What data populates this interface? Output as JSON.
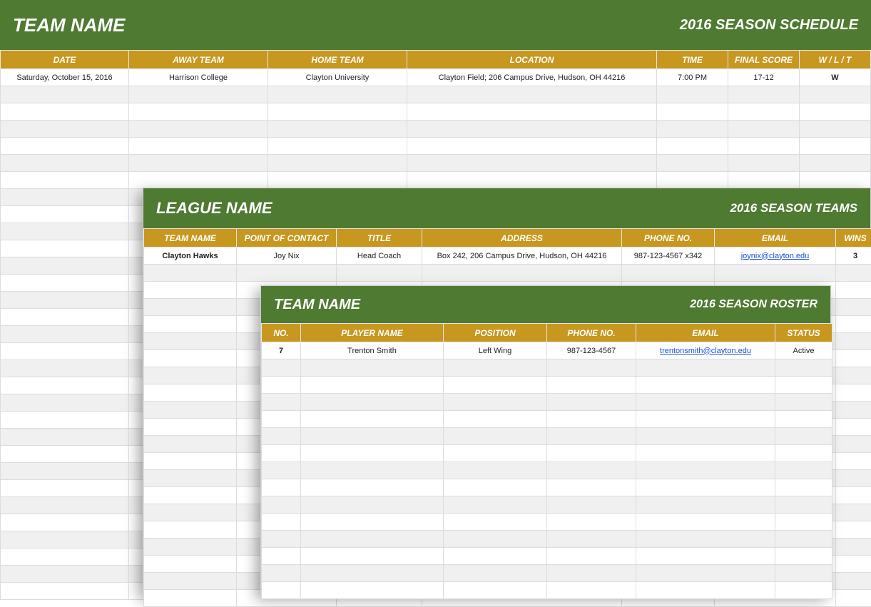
{
  "schedule": {
    "title": "TEAM NAME",
    "subtitle": "2016 SEASON SCHEDULE",
    "headers": {
      "date": "DATE",
      "away": "AWAY TEAM",
      "home": "HOME TEAM",
      "location": "LOCATION",
      "time": "TIME",
      "score": "FINAL SCORE",
      "wlt": "W / L / T"
    },
    "row": {
      "date": "Saturday, October 15, 2016",
      "away": "Harrison College",
      "home": "Clayton University",
      "location": "Clayton Field; 206 Campus Drive, Hudson, OH  44216",
      "time": "7:00 PM",
      "score": "17-12",
      "wlt": "W"
    }
  },
  "league": {
    "title": "LEAGUE NAME",
    "subtitle": "2016 SEASON TEAMS",
    "headers": {
      "team": "TEAM NAME",
      "poc": "POINT OF CONTACT",
      "title": "TITLE",
      "address": "ADDRESS",
      "phone": "PHONE NO.",
      "email": "EMAIL",
      "wins": "WINS"
    },
    "row": {
      "team": "Clayton Hawks",
      "poc": "Joy Nix",
      "title": "Head Coach",
      "address": "Box 242, 206 Campus Drive, Hudson, OH  44216",
      "phone": "987-123-4567 x342",
      "email": "joynix@clayton.edu",
      "wins": "3"
    }
  },
  "roster": {
    "title": "TEAM NAME",
    "subtitle": "2016 SEASON ROSTER",
    "headers": {
      "no": "NO.",
      "name": "PLAYER NAME",
      "position": "POSITION",
      "phone": "PHONE NO.",
      "email": "EMAIL",
      "status": "STATUS"
    },
    "row": {
      "no": "7",
      "name": "Trenton Smith",
      "position": "Left Wing",
      "phone": "987-123-4567",
      "email": "trentonsmith@clayton.edu",
      "status": "Active"
    }
  }
}
